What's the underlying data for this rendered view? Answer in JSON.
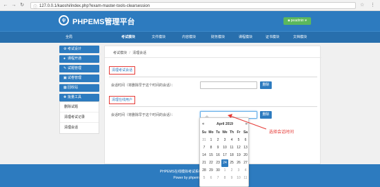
{
  "browser": {
    "url": "127.0.0.1/kaoshi/index.php?exam-master-tools-clearsession"
  },
  "header": {
    "brand": "PHPEMS管理平台",
    "user_label": "peadmin"
  },
  "topnav": {
    "items": [
      {
        "label": "全局"
      },
      {
        "label": "考试模块"
      },
      {
        "label": "文件模块"
      },
      {
        "label": "内容模块"
      },
      {
        "label": "财务模块"
      },
      {
        "label": "课程模块"
      },
      {
        "label": "证书模块"
      },
      {
        "label": "文档模块"
      }
    ],
    "active_index": 1
  },
  "sidebar": {
    "items": [
      {
        "label": "考试设计"
      },
      {
        "label": "课程开通"
      },
      {
        "label": "试题管理"
      },
      {
        "label": "试卷管理"
      },
      {
        "label": "回收站"
      },
      {
        "label": "批量工具"
      }
    ],
    "sub_items": [
      {
        "label": "删除试题"
      },
      {
        "label": "清理考试记录"
      },
      {
        "label": "清理会话"
      }
    ]
  },
  "breadcrumb": {
    "parent": "考试模块",
    "separator": "/",
    "current": "清理会话"
  },
  "sections": [
    {
      "title": "清理考试会话",
      "field_label": "会话时间（将删除早于这个时间的会话）：",
      "value": "",
      "button": "删除"
    },
    {
      "title": "清理在线用户",
      "field_label": "会话时间（将删除早于这个时间的会话）：",
      "value": "",
      "button": "删除"
    }
  ],
  "footer": {
    "line1": "PHPEMS在线模拟考试系统 著作权所有",
    "line2": "Power by phpems.net"
  },
  "datepicker": {
    "month_title": "April 2019",
    "prev": "«",
    "next": "»",
    "weekdays": [
      "Su",
      "Mo",
      "Tu",
      "We",
      "Th",
      "Fr",
      "Sa"
    ],
    "days": [
      {
        "d": "31",
        "old": true
      },
      {
        "d": "1"
      },
      {
        "d": "2"
      },
      {
        "d": "3"
      },
      {
        "d": "4"
      },
      {
        "d": "5"
      },
      {
        "d": "6"
      },
      {
        "d": "7"
      },
      {
        "d": "8"
      },
      {
        "d": "9"
      },
      {
        "d": "10"
      },
      {
        "d": "11"
      },
      {
        "d": "12"
      },
      {
        "d": "13"
      },
      {
        "d": "14"
      },
      {
        "d": "15"
      },
      {
        "d": "16"
      },
      {
        "d": "17"
      },
      {
        "d": "18"
      },
      {
        "d": "19"
      },
      {
        "d": "20"
      },
      {
        "d": "21"
      },
      {
        "d": "22"
      },
      {
        "d": "23"
      },
      {
        "d": "24",
        "today": true
      },
      {
        "d": "25"
      },
      {
        "d": "26"
      },
      {
        "d": "27"
      },
      {
        "d": "28"
      },
      {
        "d": "29"
      },
      {
        "d": "30"
      },
      {
        "d": "1",
        "old": true
      },
      {
        "d": "2",
        "old": true
      },
      {
        "d": "3",
        "old": true
      },
      {
        "d": "4",
        "old": true
      },
      {
        "d": "5",
        "old": true
      },
      {
        "d": "6",
        "old": true
      },
      {
        "d": "7",
        "old": true
      },
      {
        "d": "8",
        "old": true
      },
      {
        "d": "9",
        "old": true
      },
      {
        "d": "10",
        "old": true
      },
      {
        "d": "11",
        "old": true
      }
    ]
  },
  "annotation": {
    "text": "选择会话时间",
    "color": "#e53935"
  },
  "colors": {
    "primary": "#2d7bbf",
    "highlight": "#e53935",
    "success": "#5cb85c"
  }
}
